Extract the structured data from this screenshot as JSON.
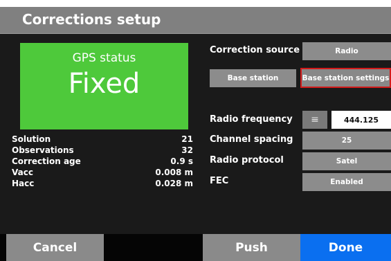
{
  "title": "Corrections setup",
  "gps": {
    "label": "GPS status",
    "state": "Fixed"
  },
  "stats": [
    {
      "key": "Solution",
      "value": "21"
    },
    {
      "key": "Observations",
      "value": "32"
    },
    {
      "key": "Correction age",
      "value": "0.9 s"
    },
    {
      "key": "Vacc",
      "value": "0.008 m"
    },
    {
      "key": "Hacc",
      "value": "0.028 m"
    }
  ],
  "settings": {
    "correction_source_label": "Correction source",
    "correction_source_value": "Radio",
    "base_station_button": "Base station",
    "base_station_settings_button": "Base station settings",
    "radio_frequency_label": "Radio frequency",
    "menu_glyph": "≡",
    "radio_frequency_value": "444.125",
    "channel_spacing_label": "Channel spacing",
    "channel_spacing_value": "25",
    "radio_protocol_label": "Radio protocol",
    "radio_protocol_value": "Satel",
    "fec_label": "FEC",
    "fec_value": "Enabled"
  },
  "footer": {
    "cancel": "Cancel",
    "push": "Push",
    "done": "Done"
  },
  "colors": {
    "status_fixed": "#4ec93b",
    "accent_done": "#0a6ff0",
    "highlight_border": "#d31a1a",
    "button_gray": "#8c8c8c"
  },
  "icons": {
    "menu": "menu-icon"
  }
}
